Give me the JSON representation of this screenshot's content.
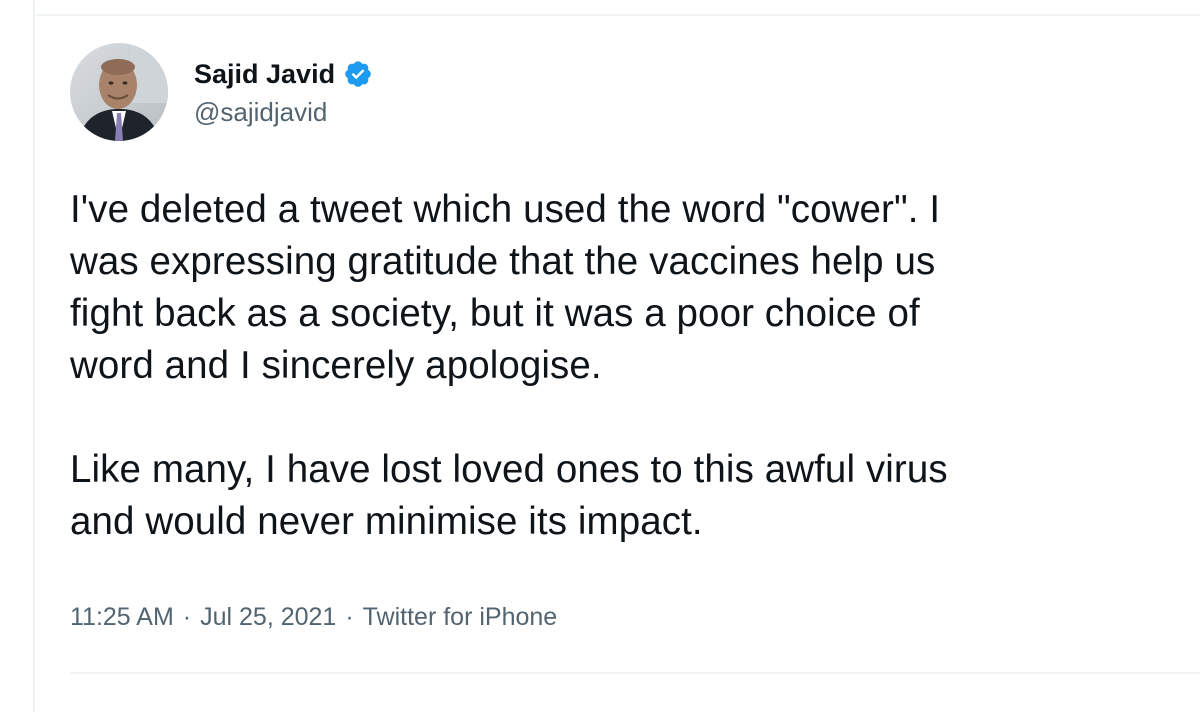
{
  "tweet": {
    "author": {
      "display_name": "Sajid Javid",
      "handle": "@sajidjavid",
      "verified": true,
      "verified_icon": "verified-badge-icon",
      "avatar": "profile-photo"
    },
    "text": {
      "paragraph_1": [
        "I've deleted a tweet which used the word \"cower\". I",
        "was expressing gratitude that the vaccines help us",
        "fight back as a society, but it was a poor choice of",
        "word and I sincerely apologise."
      ],
      "paragraph_2": [
        "Like many, I have lost loved ones to this awful virus",
        "and would never minimise its impact."
      ]
    },
    "meta": {
      "time": "11:25 AM",
      "separator": "·",
      "date": "Jul 25, 2021",
      "source": "Twitter for iPhone"
    }
  },
  "colors": {
    "text_primary": "#0f1419",
    "text_secondary": "#536471",
    "verified_blue": "#1d9bf0",
    "border": "#eff3f4"
  }
}
